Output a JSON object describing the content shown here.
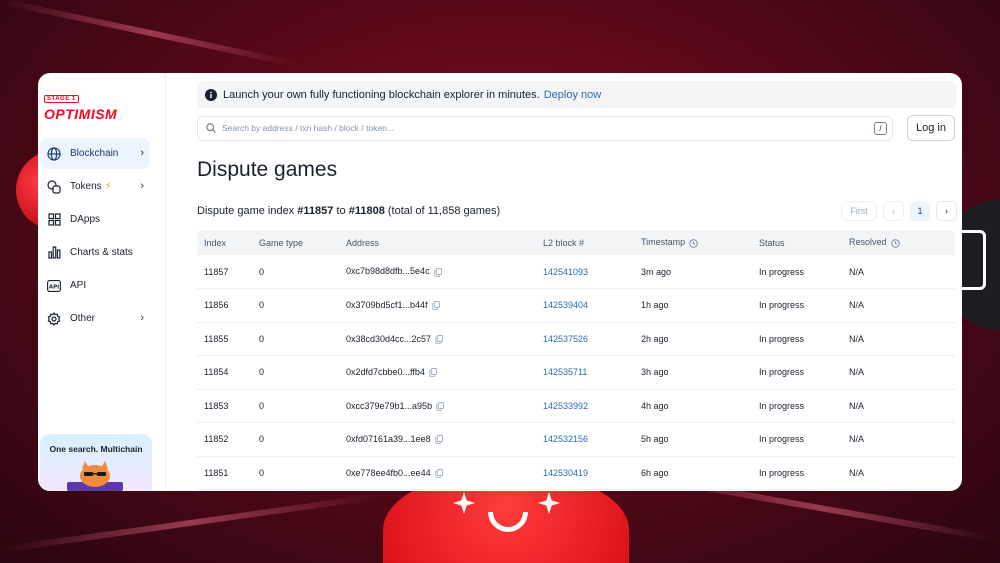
{
  "sidebar": {
    "logo": {
      "stage": "STAGE 1",
      "brand": "OPTIMISM"
    },
    "items": [
      {
        "label": "Blockchain",
        "icon": "globe-icon",
        "active": true,
        "chevron": true
      },
      {
        "label": "Tokens",
        "icon": "tokens-icon",
        "active": false,
        "chevron": true,
        "badge": "⚡"
      },
      {
        "label": "DApps",
        "icon": "grid-icon",
        "active": false,
        "chevron": false
      },
      {
        "label": "Charts & stats",
        "icon": "bar-chart-icon",
        "active": false,
        "chevron": false
      },
      {
        "label": "API",
        "icon": "api-icon",
        "active": false,
        "chevron": false
      },
      {
        "label": "Other",
        "icon": "gear-icon",
        "active": false,
        "chevron": true
      }
    ],
    "promo": {
      "text": "One search. Multichain"
    }
  },
  "banner": {
    "text": "Launch your own fully functioning blockchain explorer in minutes.",
    "link": "Deploy now"
  },
  "search": {
    "placeholder": "Search by address / txn hash / block / token...",
    "shortcut": "/"
  },
  "login_label": "Log in",
  "page_title": "Dispute games",
  "summary": {
    "prefix": "Dispute game index",
    "from": "#11857",
    "to_word": "to",
    "to": "#11808",
    "total": "(total of 11,858 games)"
  },
  "pagination": {
    "first": "First",
    "prev": "‹",
    "page": "1",
    "next": "›"
  },
  "table": {
    "headers": [
      "Index",
      "Game type",
      "Address",
      "L2 block #",
      "Timestamp",
      "Status",
      "Resolved"
    ],
    "rows": [
      {
        "index": "11857",
        "game_type": "0",
        "address": "0xc7b98d8dfb...5e4c",
        "l2_block": "142541093",
        "timestamp": "3m ago",
        "status": "In progress",
        "resolved": "N/A"
      },
      {
        "index": "11856",
        "game_type": "0",
        "address": "0x3709bd5cf1...b44f",
        "l2_block": "142539404",
        "timestamp": "1h ago",
        "status": "In progress",
        "resolved": "N/A"
      },
      {
        "index": "11855",
        "game_type": "0",
        "address": "0x38cd30d4cc...2c57",
        "l2_block": "142537526",
        "timestamp": "2h ago",
        "status": "In progress",
        "resolved": "N/A"
      },
      {
        "index": "11854",
        "game_type": "0",
        "address": "0x2dfd7cbbe0...ffb4",
        "l2_block": "142535711",
        "timestamp": "3h ago",
        "status": "In progress",
        "resolved": "N/A"
      },
      {
        "index": "11853",
        "game_type": "0",
        "address": "0xcc379e79b1...a95b",
        "l2_block": "142533992",
        "timestamp": "4h ago",
        "status": "In progress",
        "resolved": "N/A"
      },
      {
        "index": "11852",
        "game_type": "0",
        "address": "0xfd07161a39...1ee8",
        "l2_block": "142532156",
        "timestamp": "5h ago",
        "status": "In progress",
        "resolved": "N/A"
      },
      {
        "index": "11851",
        "game_type": "0",
        "address": "0xe778ee4fb0...ee44",
        "l2_block": "142530419",
        "timestamp": "6h ago",
        "status": "In progress",
        "resolved": "N/A"
      }
    ]
  },
  "colors": {
    "brand": "#ff0420",
    "link": "#2b6cb0",
    "active_bg": "#ebf4ff"
  }
}
